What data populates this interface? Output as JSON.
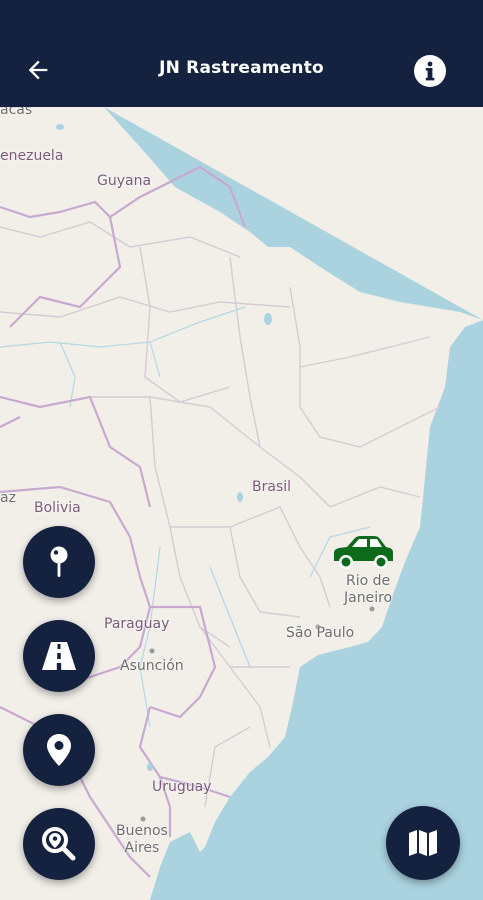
{
  "app": {
    "title": "JN Rastreamento",
    "back_icon": "arrow-left-icon",
    "info_icon": "info-circle-icon"
  },
  "map": {
    "labels": {
      "caracas": "acas",
      "venezuela": "enezuela",
      "guyana": "Guyana",
      "brasil": "Brasil",
      "bolivia": "Bolivia",
      "paz": "az",
      "rio_line1": "Rio de",
      "rio_line2": "Janeiro",
      "sao_paulo": "São Paulo",
      "paraguay": "Paraguay",
      "asuncion": "Asunción",
      "uruguay": "Uruguay",
      "buenos_line1": "Buenos",
      "buenos_line2": "Aires"
    },
    "colors": {
      "land": "#f2efe9",
      "water": "#aad3df",
      "border": "#c8a9cf",
      "appbar": "#14223f",
      "vehicle": "#0b6b1b"
    }
  },
  "controls": {
    "fab_pin": "pushpin-icon",
    "fab_route": "road-icon",
    "fab_location": "location-marker-icon",
    "fab_search": "search-location-icon",
    "fab_map_type": "map-icon"
  },
  "vehicle": {
    "icon": "car-icon"
  }
}
